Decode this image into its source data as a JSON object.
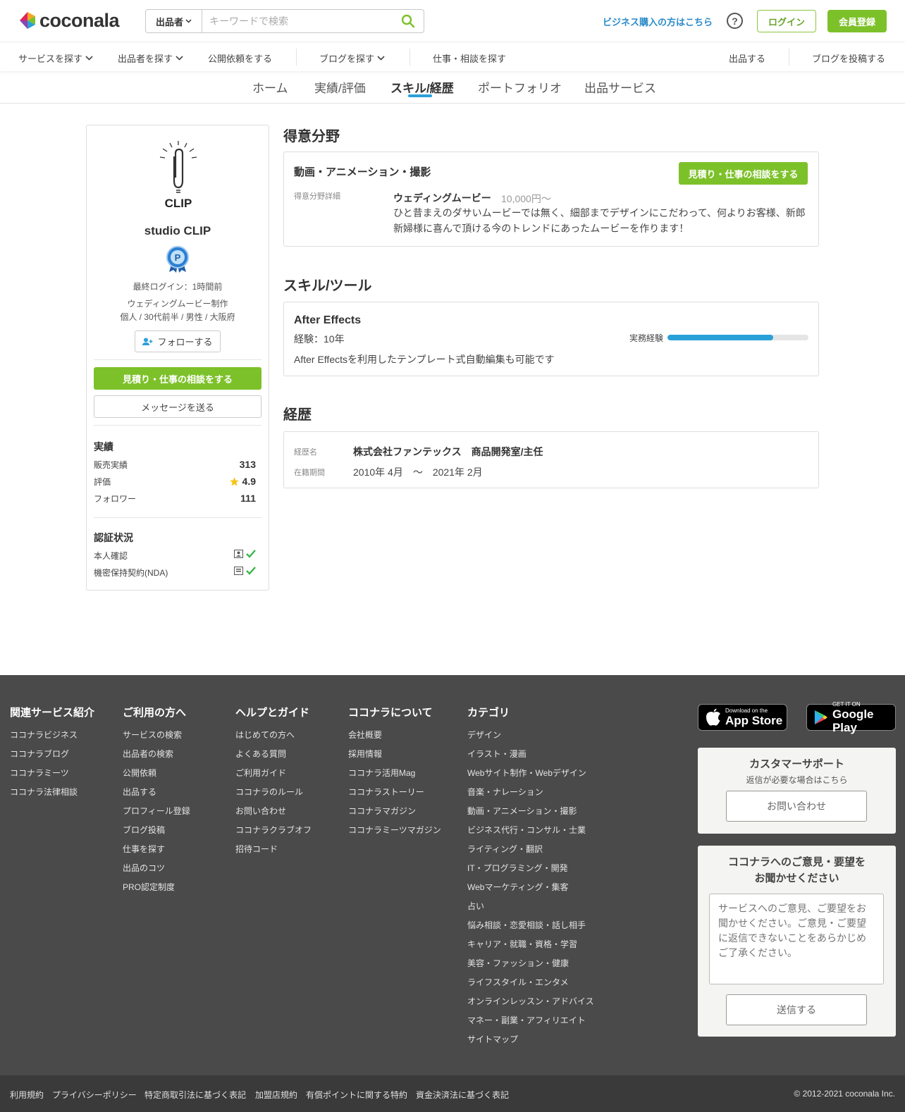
{
  "header": {
    "logo_text": "coconala",
    "search_category": "出品者",
    "search_placeholder": "キーワードで検索",
    "business_link": "ビジネス購入の方はこちら",
    "help_label": "?",
    "login": "ログイン",
    "signup": "会員登録"
  },
  "nav": {
    "find_services": "サービスを探す",
    "find_sellers": "出品者を探す",
    "public_request": "公開依頼をする",
    "find_blogs": "ブログを探す",
    "find_jobs": "仕事・相談を探す",
    "sell": "出品する",
    "post_blog": "ブログを投稿する"
  },
  "tabs": {
    "home": "ホーム",
    "results": "実績/評価",
    "skills": "スキル/経歴",
    "portfolio": "ポートフォリオ",
    "services": "出品サービス"
  },
  "profile": {
    "logo_caption": "CLIP",
    "name": "studio CLIP",
    "last_login": "最終ログイン：1時間前",
    "job": "ウェディングムービー制作",
    "info": "個人 / 30代前半 / 男性 / 大阪府",
    "follow": "フォローする",
    "consult": "見積り・仕事の相談をする",
    "message": "メッセージを送る",
    "stats_title": "実績",
    "sales_label": "販売実績",
    "sales_value": "313",
    "rating_label": "評価",
    "rating_value": "4.9",
    "followers_label": "フォロワー",
    "followers_value": "111",
    "verify_title": "認証状況",
    "identity_label": "本人確認",
    "nda_label": "機密保持契約(NDA)"
  },
  "specialty": {
    "title": "得意分野",
    "category": "動画・アニメーション・撮影",
    "consult": "見積り・仕事の相談をする",
    "detail_label": "得意分野詳細",
    "item_name": "ウェディングムービー",
    "price": "10,000円〜",
    "description": "ひと昔まえのダサいムービーでは無く、細部までデザインにこだわって、何よりお客様、新郎新婦様に喜んで頂ける今のトレンドにあったムービーを作ります！"
  },
  "skills": {
    "title": "スキル/ツール",
    "name": "After Effects",
    "experience": "経験：10年",
    "practice_label": "実務経験",
    "practice_level": 0.75,
    "description": "After Effectsを利用したテンプレート式自動編集も可能です"
  },
  "career": {
    "title": "経歴",
    "name_label": "経歴名",
    "name_value": "株式会社ファンテックス　商品開発室/主任",
    "period_label": "在籍期間",
    "period_value": "2010年 4月　〜　2021年 2月"
  },
  "footer": {
    "col1": {
      "title": "関連サービス紹介",
      "links": [
        "ココナラビジネス",
        "ココナラブログ",
        "ココナラミーツ",
        "ココナラ法律相談"
      ]
    },
    "col2": {
      "title": "ご利用の方へ",
      "links": [
        "サービスの検索",
        "出品者の検索",
        "公開依頼",
        "出品する",
        "プロフィール登録",
        "ブログ投稿",
        "仕事を探す",
        "出品のコツ",
        "PRO認定制度"
      ]
    },
    "col3": {
      "title": "ヘルプとガイド",
      "links": [
        "はじめての方へ",
        "よくある質問",
        "ご利用ガイド",
        "ココナラのルール",
        "お問い合わせ",
        "ココナラクラブオフ",
        "招待コード"
      ]
    },
    "col4": {
      "title": "ココナラについて",
      "links": [
        "会社概要",
        "採用情報",
        "ココナラ活用Mag",
        "ココナラストーリー",
        "ココナラマガジン",
        "ココナラミーツマガジン"
      ]
    },
    "col5": {
      "title": "カテゴリ",
      "links": [
        "デザイン",
        "イラスト・漫画",
        "Webサイト制作・Webデザイン",
        "音楽・ナレーション",
        "動画・アニメーション・撮影",
        "ビジネス代行・コンサル・士業",
        "ライティング・翻訳",
        "IT・プログラミング・開発",
        "Webマーケティング・集客",
        "占い",
        "悩み相談・恋愛相談・話し相手",
        "キャリア・就職・資格・学習",
        "美容・ファッション・健康",
        "ライフスタイル・エンタメ",
        "オンラインレッスン・アドバイス",
        "マネー・副業・アフィリエイト",
        "サイトマップ"
      ]
    },
    "appstore_small": "Download on the",
    "appstore_big": "App Store",
    "googleplay_small": "GET IT ON",
    "googleplay_big": "Google Play",
    "support_title": "カスタマーサポート",
    "support_sub": "返信が必要な場合はこちら",
    "support_btn": "お問い合わせ",
    "feedback_title_1": "ココナラへのご意見・要望を",
    "feedback_title_2": "お聞かせください",
    "feedback_placeholder": "サービスへのご意見、ご要望をお聞かせください。ご意見・ご要望に返信できないことをあらかじめご了承ください。",
    "feedback_btn": "送信する"
  },
  "bottom": {
    "links": [
      "利用規約",
      "プライバシーポリシー",
      "特定商取引法に基づく表記",
      "加盟店規約",
      "有償ポイントに関する特約",
      "資金決済法に基づく表記"
    ],
    "copyright": "© 2012-2021 coconala Inc."
  },
  "colors": {
    "brand_green": "#7dc12a",
    "accent_blue": "#2aa0d8",
    "footer_bg": "#4a4a4a"
  }
}
